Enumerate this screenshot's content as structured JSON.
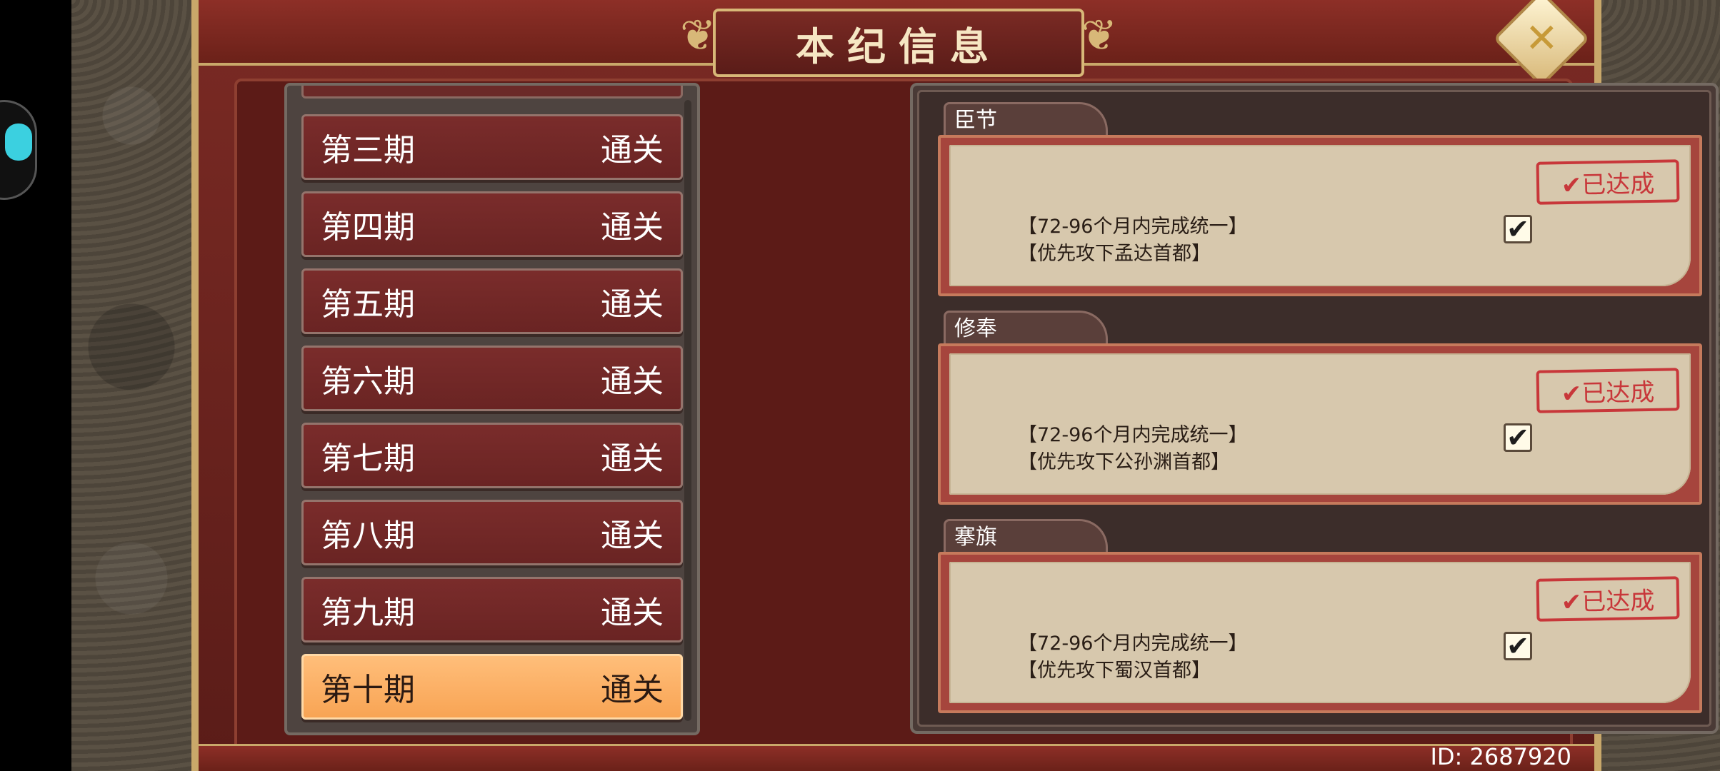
{
  "window": {
    "title": "本纪信息"
  },
  "close": {
    "glyph": "✕"
  },
  "periods": [
    {
      "name": "第三期",
      "status": "通关"
    },
    {
      "name": "第四期",
      "status": "通关"
    },
    {
      "name": "第五期",
      "status": "通关"
    },
    {
      "name": "第六期",
      "status": "通关"
    },
    {
      "name": "第七期",
      "status": "通关"
    },
    {
      "name": "第八期",
      "status": "通关"
    },
    {
      "name": "第九期",
      "status": "通关"
    },
    {
      "name": "第十期",
      "status": "通关",
      "selected": true
    }
  ],
  "tasks": [
    {
      "tab": "臣节",
      "line1": "【72-96个月内完成统一】",
      "line2": "【优先攻下孟达首都】",
      "stamp": "✔已达成",
      "checked": "✔"
    },
    {
      "tab": "修奉",
      "line1": "【72-96个月内完成统一】",
      "line2": "【优先攻下公孙渊首都】",
      "stamp": "✔已达成",
      "checked": "✔"
    },
    {
      "tab": "搴旗",
      "line1": "【72-96个月内完成统一】",
      "line2": "【优先攻下蜀汉首都】",
      "stamp": "✔已达成",
      "checked": "✔"
    }
  ],
  "footer": {
    "id_text": "ID: 2687920"
  },
  "colors": {
    "selected_item": "#f8a454",
    "stamp_red": "#c8373a",
    "frame_gold": "#c9a86a"
  }
}
